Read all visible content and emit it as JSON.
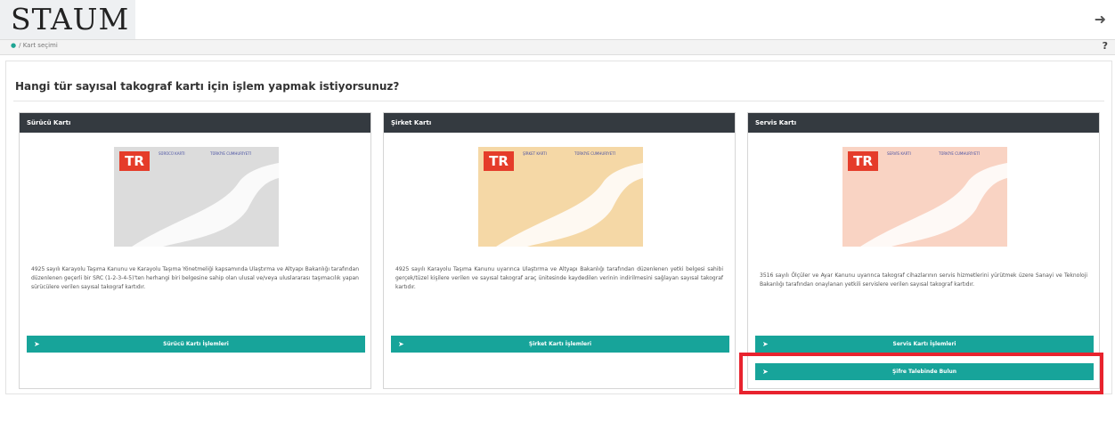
{
  "header": {
    "logo": "STAUM",
    "logout_icon": "sign-out-icon"
  },
  "breadcrumb": {
    "home_icon": "home-icon",
    "text": "/ Kart seçimi",
    "help_icon": "help-icon"
  },
  "question": "Hangi tür sayısal takograf kartı için işlem yapmak istiyorsunuz?",
  "panels": [
    {
      "title": "Sürücü Kartı",
      "card": {
        "flag": "TR",
        "label": "SÜRÜCÜ KARTI",
        "country": "TÜRKİYE CUMHURİYETİ",
        "color": "#dcdcdc"
      },
      "description": "4925 sayılı Karayolu Taşıma Kanunu ve Karayolu Taşıma Yönetmeliği kapsamında Ulaştırma ve Altyapı Bakanlığı tarafından düzenlenen geçerli bir SRC (1-2-3-4-5)'ten herhangi biri belgesine sahip olan ulusal ve/veya uluslararası taşımacılık yapan sürücülere verilen sayısal takograf kartıdır.",
      "buttons": [
        "Sürücü Kartı İşlemleri"
      ]
    },
    {
      "title": "Şirket Kartı",
      "card": {
        "flag": "TR",
        "label": "ŞİRKET KARTI",
        "country": "TÜRKİYE CUMHURİYETİ",
        "color": "#f5d8a6"
      },
      "description": "4925 sayılı Karayolu Taşıma Kanunu uyarınca Ulaştırma ve Altyapı Bakanlığı tarafından düzenlenen yetki belgesi sahibi gerçek/tüzel kişilere verilen ve sayısal takograf araç ünitesinde kaydedilen verinin indirilmesini sağlayan sayısal takograf kartıdır.",
      "buttons": [
        "Şirket Kartı İşlemleri"
      ]
    },
    {
      "title": "Servis Kartı",
      "card": {
        "flag": "TR",
        "label": "SERVİS KARTI",
        "country": "TÜRKİYE CUMHURİYETİ",
        "color": "#f9d3c3"
      },
      "description": "3516 sayılı Ölçüler ve Ayar Kanunu uyarınca takograf cihazlarının servis hizmetlerini yürütmek üzere Sanayi ve Teknoloji Bakanlığı tarafından onaylanan yetkili servislere verilen sayısal takograf kartıdır.",
      "buttons": [
        "Servis Kartı İşlemleri",
        "Şifre Talebinde Bulun"
      ]
    }
  ],
  "colors": {
    "accent": "#17a49a",
    "panel_header": "#343a40",
    "highlight": "#e8232e"
  }
}
